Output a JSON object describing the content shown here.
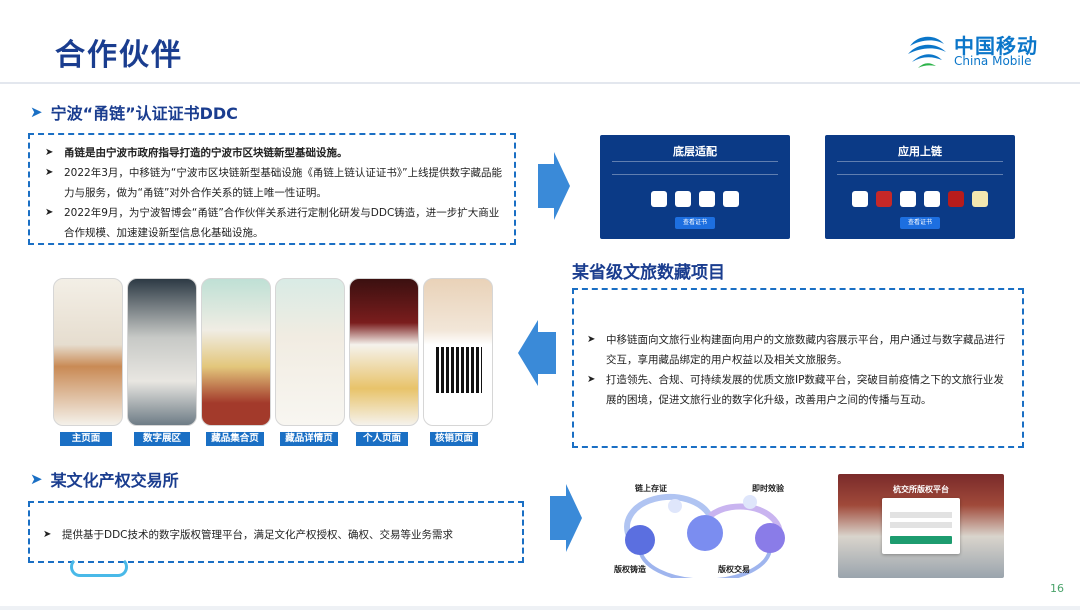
{
  "title": "合作伙伴",
  "logo": {
    "cn": "中国移动",
    "en": "China Mobile"
  },
  "section1": {
    "heading": "宁波“甬链”认证证书DDC",
    "bullets": [
      "甬链是由宁波市政府指导打造的宁波市区块链新型基础设施。",
      "2022年3月，中移链为“宁波市区块链新型基础设施《甬链上链认证证书》”上线提供数字藏品能力与服务，做为“甬链”对外合作关系的链上唯一性证明。",
      "2022年9月，为宁波智博会“甬链”合作伙伴关系进行定制化研发与DDC铸造，进一步扩大商业合作规模、加速建设新型信息化基础设施。"
    ],
    "screens": [
      {
        "title": "底层适配",
        "button": "查看证书"
      },
      {
        "title": "应用上链",
        "button": "查看证书"
      }
    ]
  },
  "section2": {
    "heading": "某省级文旅数藏项目",
    "bullets": [
      "中移链面向文旅行业构建面向用户的文旅数藏内容展示平台，用户通过与数字藏品进行交互，享用藏品绑定的用户权益以及相关文旅服务。",
      "打造领先、合规、可持续发展的优质文旅IP数藏平台，突破目前疫情之下的文旅行业发展的困境，促进文旅行业的数字化升级，改善用户之间的传播与互动。"
    ],
    "phone_labels": [
      "主页面",
      "数字展区",
      "藏品集合页",
      "藏品详情页",
      "个人页面",
      "核销页面"
    ]
  },
  "section3": {
    "heading": "某文化产权交易所",
    "bullets": [
      "提供基于DDC技术的数字版权管理平台，满足文化产权授权、确权、交易等业务需求"
    ],
    "diagram_labels": [
      "链上存证",
      "即时效验",
      "版权铸造",
      "版权交易"
    ],
    "platform_title": "杭交所版权平台"
  },
  "page_number": "16",
  "colors": {
    "accent": "#1a6fc4",
    "title": "#1a3d8f",
    "page_number": "#4aa36a"
  }
}
